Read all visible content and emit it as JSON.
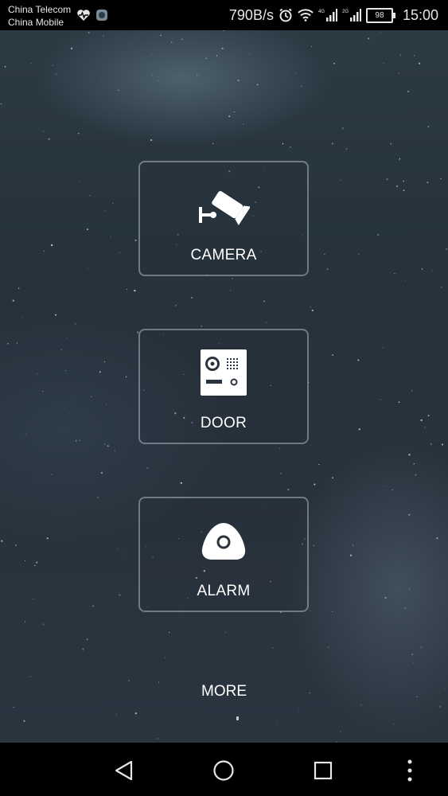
{
  "status_bar": {
    "carrier_1": "China Telecom",
    "carrier_2": "China Mobile",
    "speed": "790B/s",
    "battery": "98",
    "time": "15:00",
    "icons": [
      "heart-pulse-icon",
      "app-icon",
      "alarm-clock-icon",
      "wifi-icon",
      "signal-4g-icon",
      "signal-2g-icon",
      "battery-icon"
    ]
  },
  "tiles": [
    {
      "label": "CAMERA",
      "icon": "security-camera-icon"
    },
    {
      "label": "DOOR",
      "icon": "door-intercom-icon"
    },
    {
      "label": "ALARM",
      "icon": "alarm-sensor-icon"
    }
  ],
  "more_label": "MORE",
  "nav_bar": {
    "icons": [
      "back-triangle-icon",
      "home-circle-icon",
      "recents-square-icon",
      "overflow-menu-icon"
    ]
  },
  "colors": {
    "background": "#27323c",
    "status_bar": "#000000",
    "tile_border": "#c8d2dc",
    "text": "#ffffff"
  }
}
